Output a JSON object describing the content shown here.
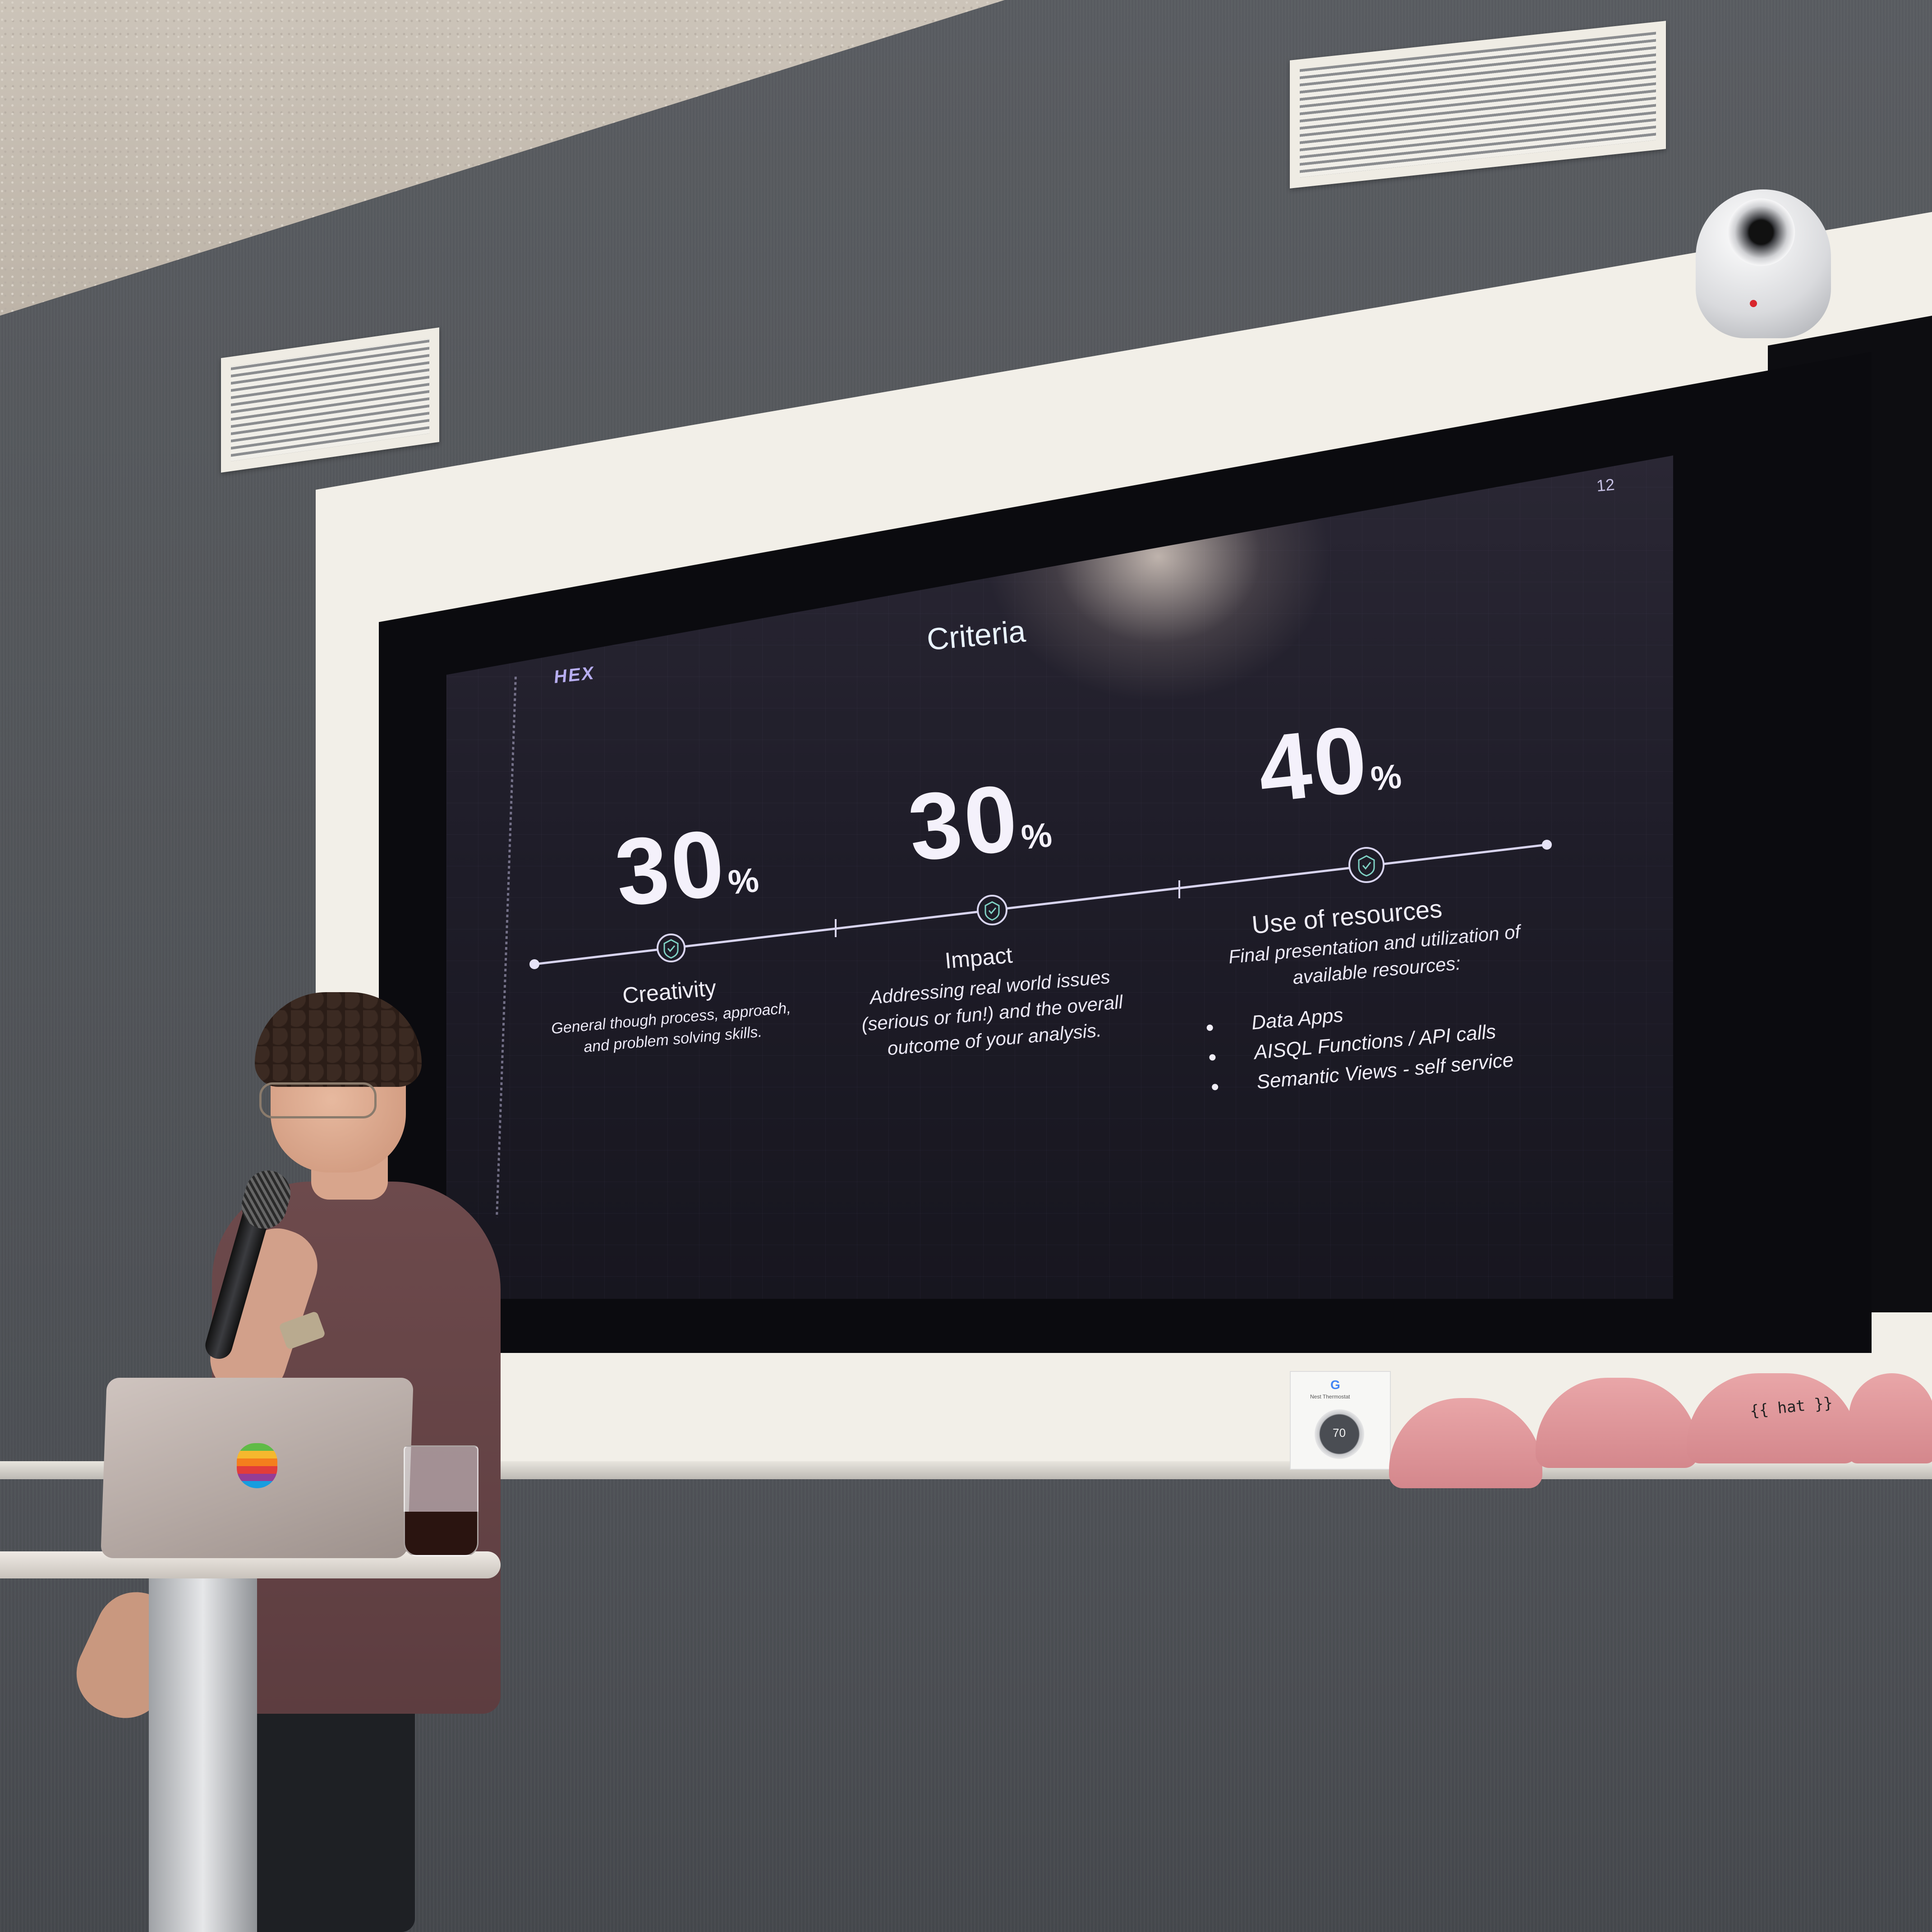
{
  "slide": {
    "page_number": "12",
    "logo": "HEX",
    "title": "Criteria",
    "criteria": [
      {
        "percent_value": "30",
        "percent_sign": "%",
        "title": "Creativity",
        "description": "General though process, approach, and problem solving skills."
      },
      {
        "percent_value": "30",
        "percent_sign": "%",
        "title": "Impact",
        "description": "Addressing real world issues (serious or fun!) and the overall outcome of your analysis."
      },
      {
        "percent_value": "40",
        "percent_sign": "%",
        "title": "Use of resources",
        "description": "Final presentation and utilization of available resources:",
        "list": [
          "Data Apps",
          "AISQL Functions / API calls",
          "Semantic Views - self service"
        ]
      }
    ]
  },
  "thermostat": {
    "brand": "G",
    "label": "Nest Thermostat",
    "temperature": "70"
  },
  "hat_text": "{{ hat }}",
  "colors": {
    "slide_background": "#1f1d29",
    "slide_text": "#f1eef8",
    "timeline_line": "#d8d4ef",
    "check_icon": "#7fd2c4",
    "logo": "#b7adf0",
    "shirt": "#6d4a4c",
    "hat": "#e9a6a8"
  },
  "icons": {
    "criteria_marker": "shield-check-icon",
    "apple_logo": "rainbow-apple-icon"
  }
}
